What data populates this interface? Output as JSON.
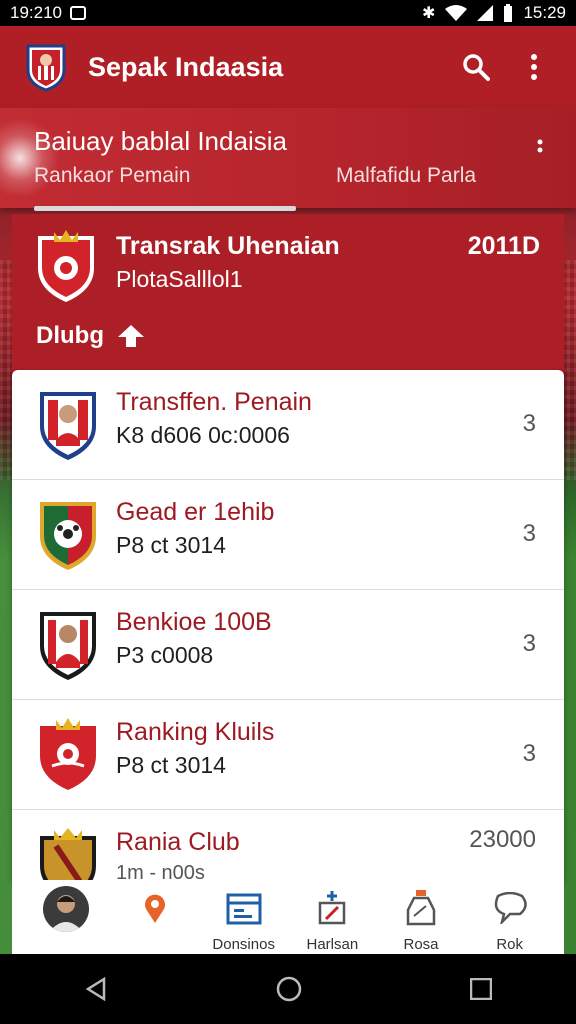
{
  "status_bar": {
    "time_left": "19:210",
    "time_right": "15:29"
  },
  "app_bar": {
    "title": "Sepak Indaasia",
    "icons": [
      "search-icon",
      "more-vert-icon"
    ]
  },
  "hero": {
    "title": "Baiuay bablal Indaisia",
    "subtitle_left": "Rankaor Pemain",
    "subtitle_right": "Malfafidu Parla"
  },
  "featured": {
    "title": "Transrak Uhenaian",
    "subtitle": "PlotaSalllol1",
    "value": "2011D",
    "club_label": "Dlubg"
  },
  "rows": [
    {
      "title": "Transffen. Penain",
      "subtitle": "K8 d606 0c:0006",
      "value": "3"
    },
    {
      "title": "Gead er 1ehib",
      "subtitle": "P8 ct 3014",
      "value": "3"
    },
    {
      "title": "Benkioe 100B",
      "subtitle": "P3 c0008",
      "value": "3"
    },
    {
      "title": "Ranking Kluils",
      "subtitle": "P8 ct 3014",
      "value": "3"
    },
    {
      "title": "Rania Club",
      "subtitle": "1m - n00s",
      "value": "23000"
    }
  ],
  "bottom_nav": [
    {
      "label": "",
      "icon": "avatar"
    },
    {
      "label": "",
      "icon": "location-pin-icon"
    },
    {
      "label": "Donsinos",
      "icon": "calendar-icon"
    },
    {
      "label": "Harlsan",
      "icon": "edit-photo-icon"
    },
    {
      "label": "Rosa",
      "icon": "bottle-icon"
    },
    {
      "label": "Rok",
      "icon": "chat-icon"
    }
  ],
  "colors": {
    "primary": "#b01e26",
    "title_red": "#9e1a22"
  }
}
